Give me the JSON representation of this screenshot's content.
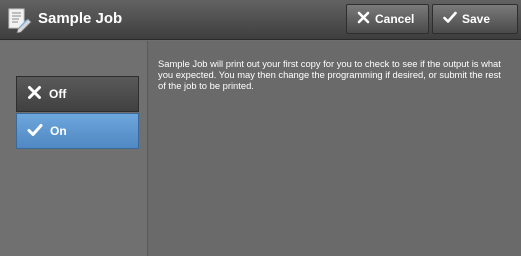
{
  "header": {
    "title": "Sample Job",
    "icon": "document-edit-icon",
    "cancel_label": "Cancel",
    "save_label": "Save"
  },
  "options": [
    {
      "label": "Off",
      "icon": "x-icon",
      "selected": false
    },
    {
      "label": "On",
      "icon": "check-icon",
      "selected": true
    }
  ],
  "description": "Sample Job will print out your first copy for you to check to see if the output is what you expected.  You may then change the programming if desired, or submit the rest of the job to be printed.",
  "colors": {
    "selected": "#5f97cf",
    "title_bar": "#4a4a4a",
    "background": "#6e6e6e"
  }
}
